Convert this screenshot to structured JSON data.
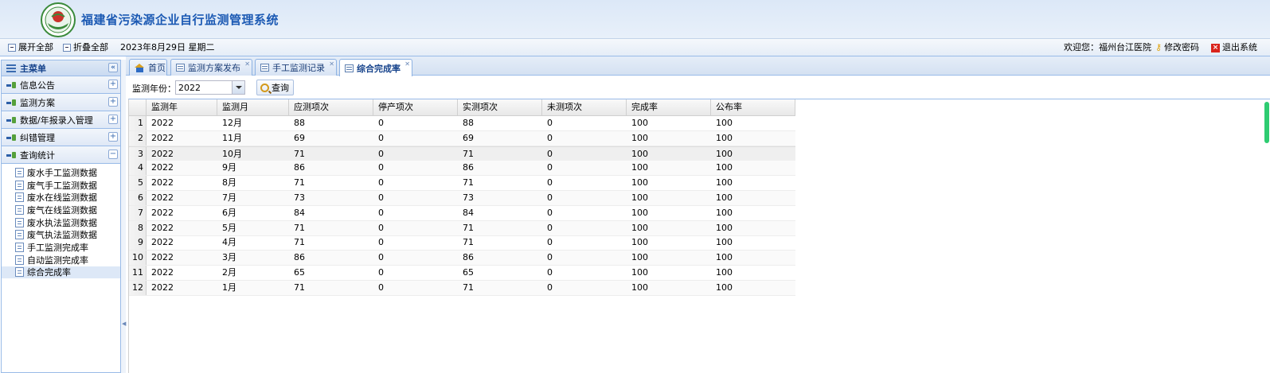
{
  "header": {
    "title": "福建省污染源企业自行监测管理系统"
  },
  "toolbar": {
    "expand_all": "展开全部",
    "collapse_all": "折叠全部",
    "date": "2023年8月29日 星期二",
    "welcome": "欢迎您：福州台江医院",
    "change_password": "修改密码",
    "logout": "退出系统"
  },
  "sidebar": {
    "title": "主菜单",
    "sections": [
      {
        "label": "信息公告",
        "toggle": "+"
      },
      {
        "label": "监测方案",
        "toggle": "+"
      },
      {
        "label": "数据/年报录入管理",
        "toggle": "+"
      },
      {
        "label": "纠错管理",
        "toggle": "+"
      },
      {
        "label": "查询统计",
        "toggle": "−"
      }
    ],
    "items": [
      "废水手工监测数据",
      "废气手工监测数据",
      "废水在线监测数据",
      "废气在线监测数据",
      "废水执法监测数据",
      "废气执法监测数据",
      "手工监测完成率",
      "自动监测完成率",
      "综合完成率"
    ]
  },
  "tabs": [
    {
      "label": "首页"
    },
    {
      "label": "监测方案发布"
    },
    {
      "label": "手工监测记录"
    },
    {
      "label": "综合完成率"
    }
  ],
  "search": {
    "year_label": "监测年份：",
    "year_value": "2022",
    "query_label": "查询"
  },
  "grid": {
    "columns": [
      "监测年",
      "监测月",
      "应测项次",
      "停产项次",
      "实测项次",
      "未测项次",
      "完成率",
      "公布率"
    ],
    "rows": [
      [
        "1",
        "2022",
        "12月",
        "88",
        "0",
        "88",
        "0",
        "100",
        "100"
      ],
      [
        "2",
        "2022",
        "11月",
        "69",
        "0",
        "69",
        "0",
        "100",
        "100"
      ],
      [
        "3",
        "2022",
        "10月",
        "71",
        "0",
        "71",
        "0",
        "100",
        "100"
      ],
      [
        "4",
        "2022",
        "9月",
        "86",
        "0",
        "86",
        "0",
        "100",
        "100"
      ],
      [
        "5",
        "2022",
        "8月",
        "71",
        "0",
        "71",
        "0",
        "100",
        "100"
      ],
      [
        "6",
        "2022",
        "7月",
        "73",
        "0",
        "73",
        "0",
        "100",
        "100"
      ],
      [
        "7",
        "2022",
        "6月",
        "84",
        "0",
        "84",
        "0",
        "100",
        "100"
      ],
      [
        "8",
        "2022",
        "5月",
        "71",
        "0",
        "71",
        "0",
        "100",
        "100"
      ],
      [
        "9",
        "2022",
        "4月",
        "71",
        "0",
        "71",
        "0",
        "100",
        "100"
      ],
      [
        "10",
        "2022",
        "3月",
        "86",
        "0",
        "86",
        "0",
        "100",
        "100"
      ],
      [
        "11",
        "2022",
        "2月",
        "65",
        "0",
        "65",
        "0",
        "100",
        "100"
      ],
      [
        "12",
        "2022",
        "1月",
        "71",
        "0",
        "71",
        "0",
        "100",
        "100"
      ]
    ]
  },
  "colors": {
    "title": "#1b59b3",
    "border": "#99bbe8",
    "scroll_thumb": "#2ecc71",
    "logout_icon": "#d9241c"
  }
}
